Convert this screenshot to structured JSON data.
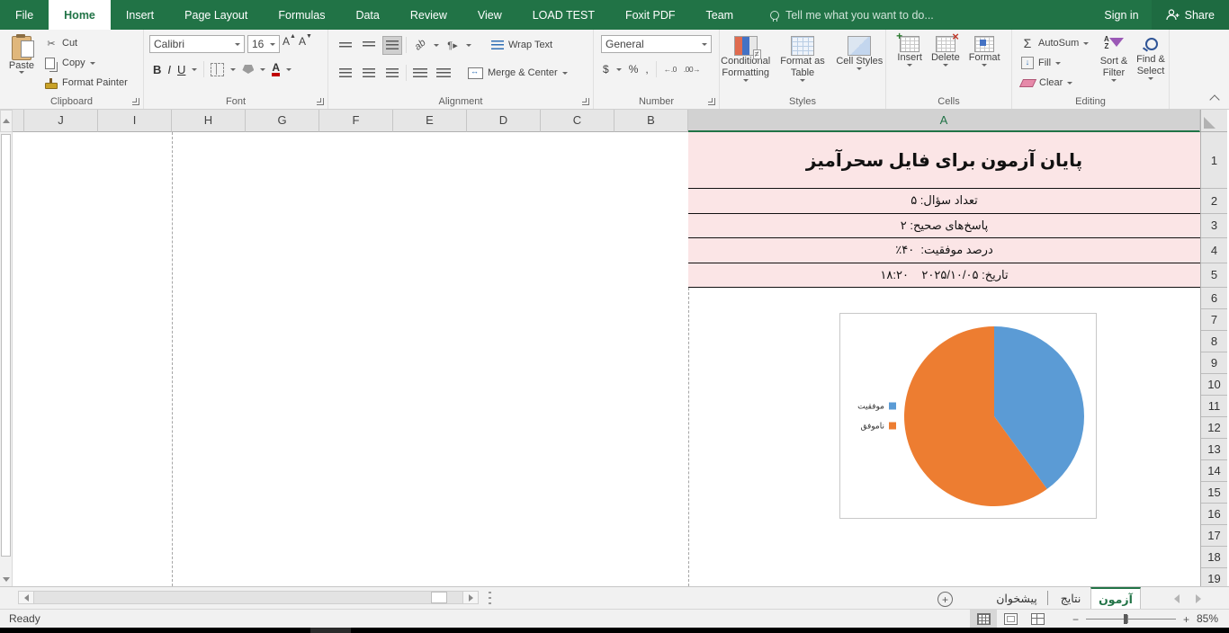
{
  "colors": {
    "accent_green": "#217346",
    "active_tab_text": "#217346",
    "cell_fill": "#fbe5e6",
    "pie_blue": "#5B9BD5",
    "pie_orange": "#ED7D31"
  },
  "ribbon_tabs": {
    "file": "File",
    "home": "Home",
    "insert": "Insert",
    "page_layout": "Page Layout",
    "formulas": "Formulas",
    "data": "Data",
    "review": "Review",
    "view": "View",
    "load_test": "LOAD TEST",
    "foxit_pdf": "Foxit PDF",
    "team": "Team",
    "tell_me": "Tell me what you want to do...",
    "sign_in": "Sign in",
    "share": "Share"
  },
  "ribbon": {
    "clipboard": {
      "group": "Clipboard",
      "paste": "Paste",
      "cut": "Cut",
      "copy": "Copy",
      "format_painter": "Format Painter"
    },
    "font": {
      "group": "Font",
      "name": "Calibri",
      "size": "16",
      "bold": "B",
      "italic": "I",
      "underline": "U"
    },
    "alignment": {
      "group": "Alignment",
      "wrap": "Wrap Text",
      "merge": "Merge & Center"
    },
    "number": {
      "group": "Number",
      "format": "General",
      "dollar": "$",
      "percent": "%",
      "comma": ",",
      "inc_decimal": "←.0",
      "dec_decimal": ".00→"
    },
    "styles": {
      "group": "Styles",
      "conditional": "Conditional Formatting",
      "format_table": "Format as Table",
      "cell_styles": "Cell Styles"
    },
    "cells": {
      "group": "Cells",
      "insert": "Insert",
      "delete": "Delete",
      "format": "Format"
    },
    "editing": {
      "group": "Editing",
      "autosum": "AutoSum",
      "fill": "Fill",
      "clear": "Clear",
      "sort_filter": "Sort & Filter",
      "find_select": "Find & Select"
    }
  },
  "icons": {
    "scissors": "✂",
    "sigma": "Σ",
    "fill_arrow": "↓",
    "grow_font": "A",
    "shrink_font": "A",
    "orientation": "ab",
    "direction": "¶▸",
    "plus": "+",
    "minus": "−"
  },
  "grid": {
    "columns": [
      "",
      "J",
      "I",
      "H",
      "G",
      "F",
      "E",
      "D",
      "C",
      "B",
      "A"
    ],
    "selected_column": "A",
    "rows": [
      "1",
      "2",
      "3",
      "4",
      "5",
      "6",
      "7",
      "8",
      "9",
      "10",
      "11",
      "12",
      "13",
      "14",
      "15",
      "16",
      "17",
      "18",
      "19"
    ],
    "data_rows": [
      {
        "text": "پایان آزمون برای فایل سحرآمیز"
      },
      {
        "text": "تعداد سؤال: ۵"
      },
      {
        "text": "پاسخ‌های صحیح: ۲"
      },
      {
        "text": "درصد موفقیت:  ۴۰٪"
      },
      {
        "text": "تاریخ: ۲۰۲۵/۱۰/۰۵    ۱۸:۲۰"
      }
    ]
  },
  "chart_data": {
    "type": "pie",
    "title": "",
    "labels": [
      "موفقیت",
      "ناموفق"
    ],
    "values": [
      40,
      60
    ],
    "colors": [
      "#5B9BD5",
      "#ED7D31"
    ],
    "legend_position": "left"
  },
  "sheet_tabs": {
    "tabs": [
      {
        "label": "آزمون",
        "active": true
      },
      {
        "label": "نتایج",
        "active": false
      },
      {
        "label": "پیشخوان",
        "active": false
      }
    ]
  },
  "status_bar": {
    "ready": "Ready",
    "zoom_level": "85%"
  }
}
